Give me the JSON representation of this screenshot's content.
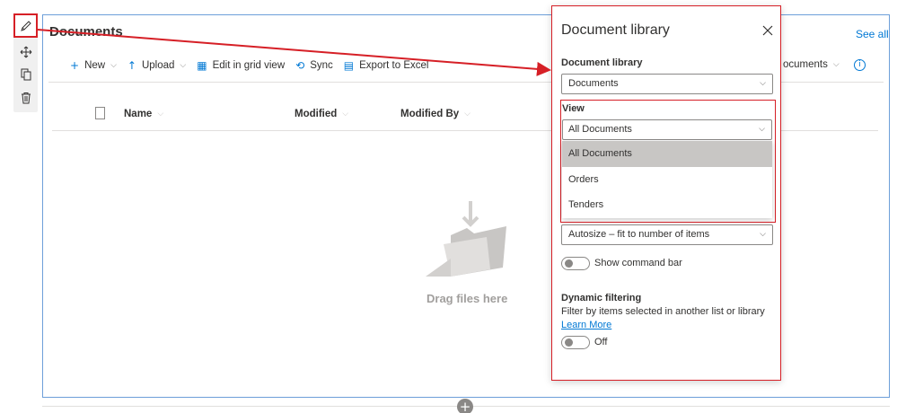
{
  "webpart": {
    "title": "Documents",
    "see_all": "See all",
    "commands": [
      {
        "label": "New",
        "icon": "plus-icon",
        "has_dropdown": true
      },
      {
        "label": "Upload",
        "icon": "upload-icon",
        "has_dropdown": true
      },
      {
        "label": "Edit in grid view",
        "icon": "grid-icon",
        "has_dropdown": false
      },
      {
        "label": "Sync",
        "icon": "sync-icon",
        "has_dropdown": false
      },
      {
        "label": "Export to Excel",
        "icon": "excel-icon",
        "has_dropdown": false
      }
    ],
    "current_view": "ocuments",
    "columns": [
      "Name",
      "Modified",
      "Modified By"
    ],
    "empty_text": "Drag files here"
  },
  "toolbar": {
    "icons": [
      "pencil-icon",
      "move-icon",
      "duplicate-icon",
      "trash-icon"
    ]
  },
  "pane": {
    "title": "Document library",
    "library_label": "Document library",
    "library_value": "Documents",
    "view_label": "View",
    "view_value": "All Documents",
    "view_options": [
      "All Documents",
      "Orders",
      "Tenders"
    ],
    "selected_option": "All Documents",
    "size_value": "Autosize – fit to number of items",
    "command_bar_label": "Show command bar",
    "command_bar_on": false,
    "dynamic_label": "Dynamic filtering",
    "dynamic_desc": "Filter by items selected in another list or library",
    "learn_more": "Learn More",
    "dynamic_state": "Off"
  },
  "colors": {
    "accent": "#0078d4",
    "highlight": "#d61f26",
    "frame": "#6d9fd9"
  }
}
